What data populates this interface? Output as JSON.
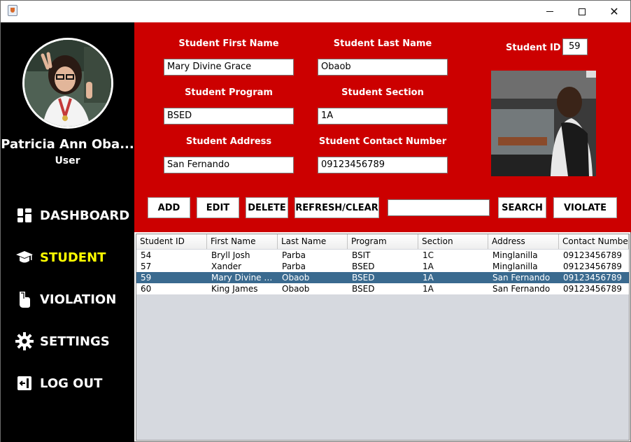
{
  "window": {
    "minimize": "",
    "maximize": "",
    "close": "✕"
  },
  "profile": {
    "name": "Patricia Ann Oba...",
    "role": "User"
  },
  "nav": [
    {
      "label": "DASHBOARD",
      "icon": "dashboard-icon"
    },
    {
      "label": "STUDENT",
      "icon": "graduation-cap-icon",
      "active": true
    },
    {
      "label": "VIOLATION",
      "icon": "hand-icon"
    },
    {
      "label": "SETTINGS",
      "icon": "gear-icon"
    },
    {
      "label": "LOG OUT",
      "icon": "logout-icon"
    }
  ],
  "form": {
    "first_name_label": "Student First Name",
    "first_name_value": "Mary Divine Grace",
    "last_name_label": "Student Last Name",
    "last_name_value": "Obaob",
    "program_label": "Student Program",
    "program_value": "BSED",
    "section_label": "Student Section",
    "section_value": "1A",
    "address_label": "Student Address",
    "address_value": "San Fernando",
    "contact_label": "Student Contact Number",
    "contact_value": "09123456789",
    "id_label": "Student ID",
    "id_value": "59"
  },
  "actions": {
    "add": "ADD",
    "edit": "EDIT",
    "delete": "DELETE",
    "refresh": "REFRESH/CLEAR",
    "search_value": "",
    "search": "SEARCH",
    "violate": "VIOLATE"
  },
  "table": {
    "columns": [
      "Student ID",
      "First Name",
      "Last Name",
      "Program",
      "Section",
      "Address",
      "Contact Number"
    ],
    "rows": [
      [
        "54",
        "Bryll Josh",
        "Parba",
        "BSIT",
        "1C",
        "Minglanilla",
        "09123456789"
      ],
      [
        "57",
        "Xander",
        "Parba",
        "BSED",
        "1A",
        "Minglanilla",
        "09123456789"
      ],
      [
        "59",
        "Mary Divine Grace",
        "Obaob",
        "BSED",
        "1A",
        "San Fernando",
        "09123456789"
      ],
      [
        "60",
        "King James",
        "Obaob",
        "BSED",
        "1A",
        "San Fernando",
        "09123456789"
      ]
    ],
    "selected_row": 2
  },
  "colors": {
    "panel_red": "#cc0000",
    "sidebar_black": "#000000",
    "active_nav": "#ffff00",
    "selected_row": "#3a6a8f"
  }
}
